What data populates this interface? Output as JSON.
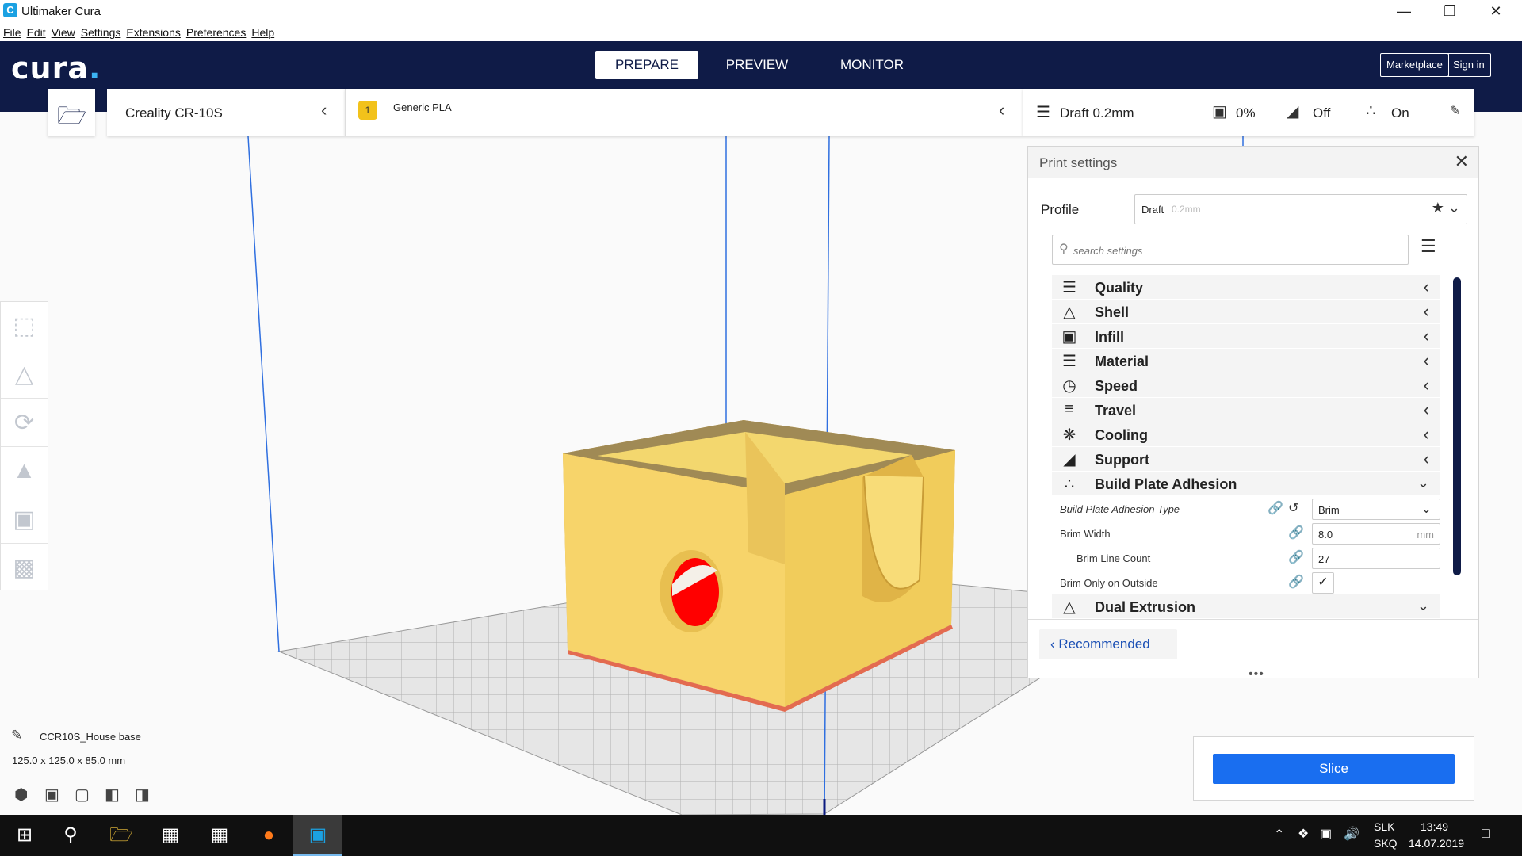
{
  "window": {
    "title": "Ultimaker Cura",
    "app_icon": "C"
  },
  "menu": [
    "File",
    "Edit",
    "View",
    "Settings",
    "Extensions",
    "Preferences",
    "Help"
  ],
  "header": {
    "logo": "cura",
    "tabs": [
      "PREPARE",
      "PREVIEW",
      "MONITOR"
    ],
    "active_tab": "PREPARE",
    "marketplace": "Marketplace",
    "sign_in": "Sign in",
    "colors": {
      "header_bg": "#0f1b47",
      "accent": "#196ef0"
    }
  },
  "printer": {
    "name": "Creality CR-10S"
  },
  "material": {
    "extruder_number": "1",
    "name": "Generic PLA"
  },
  "settings_bar": {
    "profile": "Draft 0.2mm",
    "infill": "0%",
    "support": "Off",
    "adhesion": "On"
  },
  "print_panel": {
    "title": "Print settings",
    "profile_label": "Profile",
    "profile_name": "Draft",
    "profile_layer": "0.2mm",
    "search_placeholder": "search settings",
    "categories": [
      {
        "label": "Quality",
        "icon": "quality-icon"
      },
      {
        "label": "Shell",
        "icon": "shell-icon"
      },
      {
        "label": "Infill",
        "icon": "infill-icon"
      },
      {
        "label": "Material",
        "icon": "material-icon"
      },
      {
        "label": "Speed",
        "icon": "speed-icon"
      },
      {
        "label": "Travel",
        "icon": "travel-icon"
      },
      {
        "label": "Cooling",
        "icon": "cooling-icon"
      },
      {
        "label": "Support",
        "icon": "support-icon"
      },
      {
        "label": "Build Plate Adhesion",
        "icon": "adhesion-icon"
      }
    ],
    "adhesion_settings": {
      "type_label": "Build Plate Adhesion Type",
      "type_value": "Brim",
      "width_label": "Brim Width",
      "width_value": "8.0",
      "width_unit": "mm",
      "line_count_label": "Brim Line Count",
      "line_count_value": "27",
      "outside_label": "Brim Only on Outside",
      "outside_checked": true
    },
    "dual_extrusion": "Dual Extrusion",
    "recommended": "Recommended"
  },
  "object": {
    "name": "CCR10S_House base",
    "size": "125.0 x 125.0 x 85.0 mm"
  },
  "slice_button": "Slice",
  "taskbar": {
    "lang_top": "SLK",
    "lang_bottom": "SKQ",
    "time": "13:49",
    "date": "14.07.2019"
  }
}
